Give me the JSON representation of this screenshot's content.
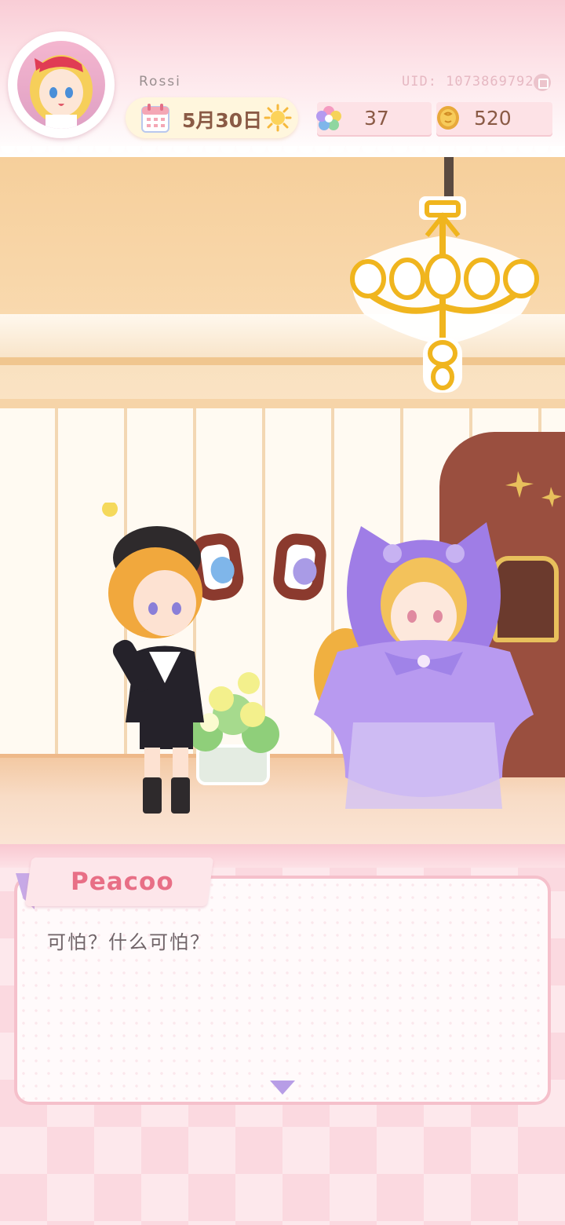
{
  "player": {
    "name": "Rossi",
    "uid": "UID: 1073869792"
  },
  "calendar": {
    "date": "5月30日",
    "weather_icon": "sun-icon"
  },
  "currencies": {
    "stars": "37",
    "coins": "520"
  },
  "dialog": {
    "speaker": "Peacoo",
    "text": "可怕？什么可怕？"
  }
}
